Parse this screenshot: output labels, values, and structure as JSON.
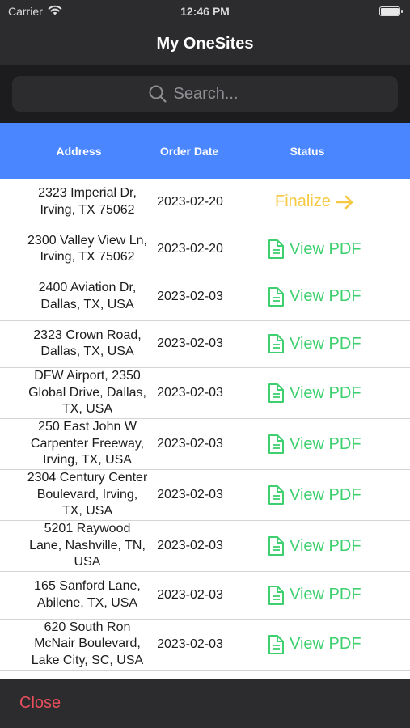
{
  "status_bar": {
    "carrier": "Carrier",
    "time": "12:46 PM"
  },
  "nav": {
    "title": "My OneSites"
  },
  "search": {
    "placeholder": "Search..."
  },
  "table": {
    "headers": {
      "address": "Address",
      "order_date": "Order Date",
      "status": "Status"
    },
    "rows": [
      {
        "address": [
          "2323 Imperial Dr,",
          "Irving, TX 75062"
        ],
        "date": "2023-02-20",
        "status": "Finalize",
        "status_type": "finalize"
      },
      {
        "address": [
          "2300 Valley View Ln,",
          "Irving, TX 75062"
        ],
        "date": "2023-02-20",
        "status": "View PDF",
        "status_type": "pdf"
      },
      {
        "address": [
          "2400 Aviation Dr,",
          "Dallas, TX, USA"
        ],
        "date": "2023-02-03",
        "status": "View PDF",
        "status_type": "pdf"
      },
      {
        "address": [
          "2323 Crown Road,",
          "Dallas, TX, USA"
        ],
        "date": "2023-02-03",
        "status": "View PDF",
        "status_type": "pdf"
      },
      {
        "address": [
          "DFW Airport, 2350",
          "Global Drive, Dallas,",
          "TX, USA"
        ],
        "date": "2023-02-03",
        "status": "View PDF",
        "status_type": "pdf"
      },
      {
        "address": [
          "250 East John W",
          "Carpenter Freeway,",
          "Irving, TX, USA"
        ],
        "date": "2023-02-03",
        "status": "View PDF",
        "status_type": "pdf"
      },
      {
        "address": [
          "2304 Century Center",
          "Boulevard, Irving,",
          "TX, USA"
        ],
        "date": "2023-02-03",
        "status": "View PDF",
        "status_type": "pdf"
      },
      {
        "address": [
          "5201 Raywood",
          "Lane, Nashville, TN,",
          "USA"
        ],
        "date": "2023-02-03",
        "status": "View PDF",
        "status_type": "pdf"
      },
      {
        "address": [
          "165 Sanford Lane,",
          "Abilene, TX, USA"
        ],
        "date": "2023-02-03",
        "status": "View PDF",
        "status_type": "pdf"
      },
      {
        "address": [
          "620 South Ron",
          "McNair Boulevard,",
          "Lake City, SC, USA"
        ],
        "date": "2023-02-03",
        "status": "View PDF",
        "status_type": "pdf"
      }
    ]
  },
  "footer": {
    "close_label": "Close"
  },
  "icons": {
    "wifi": "wifi-icon",
    "battery": "battery-icon",
    "search": "search-icon",
    "pdf": "document-icon",
    "arrow": "arrow-right-icon"
  },
  "colors": {
    "header_blue": "#4a86ff",
    "finalize_yellow": "#f5c940",
    "pdf_green": "#3ecf6e",
    "close_red": "#ea4f5d"
  }
}
